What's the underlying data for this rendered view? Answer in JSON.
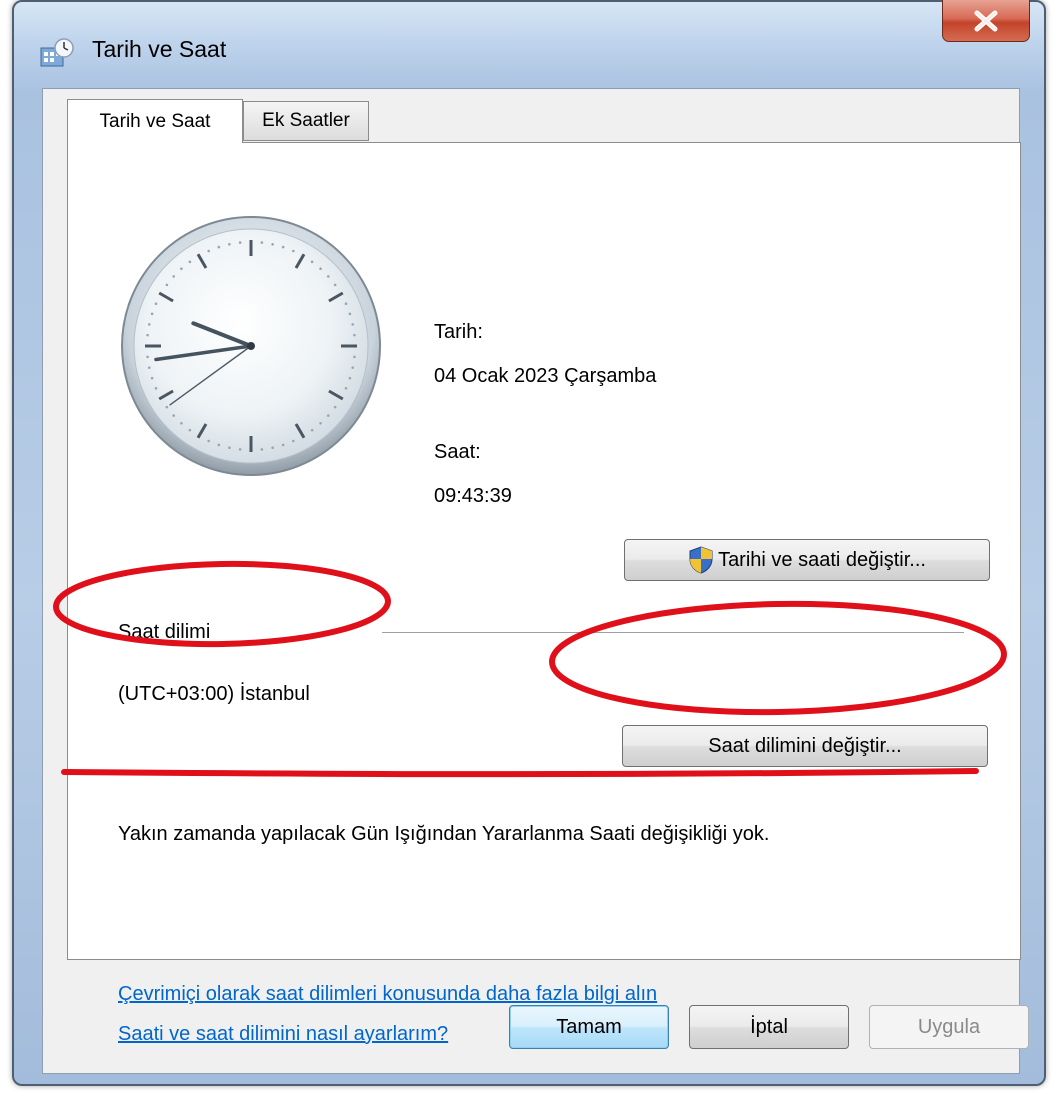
{
  "window": {
    "title": "Tarih ve Saat",
    "close_glyph": "X"
  },
  "tabs": [
    {
      "label": "Tarih ve Saat",
      "active": true
    },
    {
      "label": "Ek Saatler",
      "active": false
    }
  ],
  "clock": {
    "hour": 9,
    "minute": 43,
    "second": 39
  },
  "date": {
    "label": "Tarih:",
    "value": "04 Ocak 2023 Çarşamba"
  },
  "time": {
    "label": "Saat:",
    "value": "09:43:39"
  },
  "buttons": {
    "change_datetime": "Tarihi ve saati değiştir...",
    "change_timezone": "Saat dilimini değiştir...",
    "ok": "Tamam",
    "cancel": "İptal",
    "apply": "Uygula"
  },
  "timezone": {
    "label": "Saat dilimi",
    "value": "(UTC+03:00) İstanbul"
  },
  "dst_message": "Yakın zamanda yapılacak Gün Işığından Yararlanma Saati değişikliği yok.",
  "links": {
    "online_info": "Çevrimiçi olarak saat dilimleri konusunda daha fazla bilgi alın",
    "how_to": "Saati ve saat dilimini nasıl ayarlarım?"
  },
  "annotation_color": "#e0101a",
  "accent_color": "#0066cc"
}
